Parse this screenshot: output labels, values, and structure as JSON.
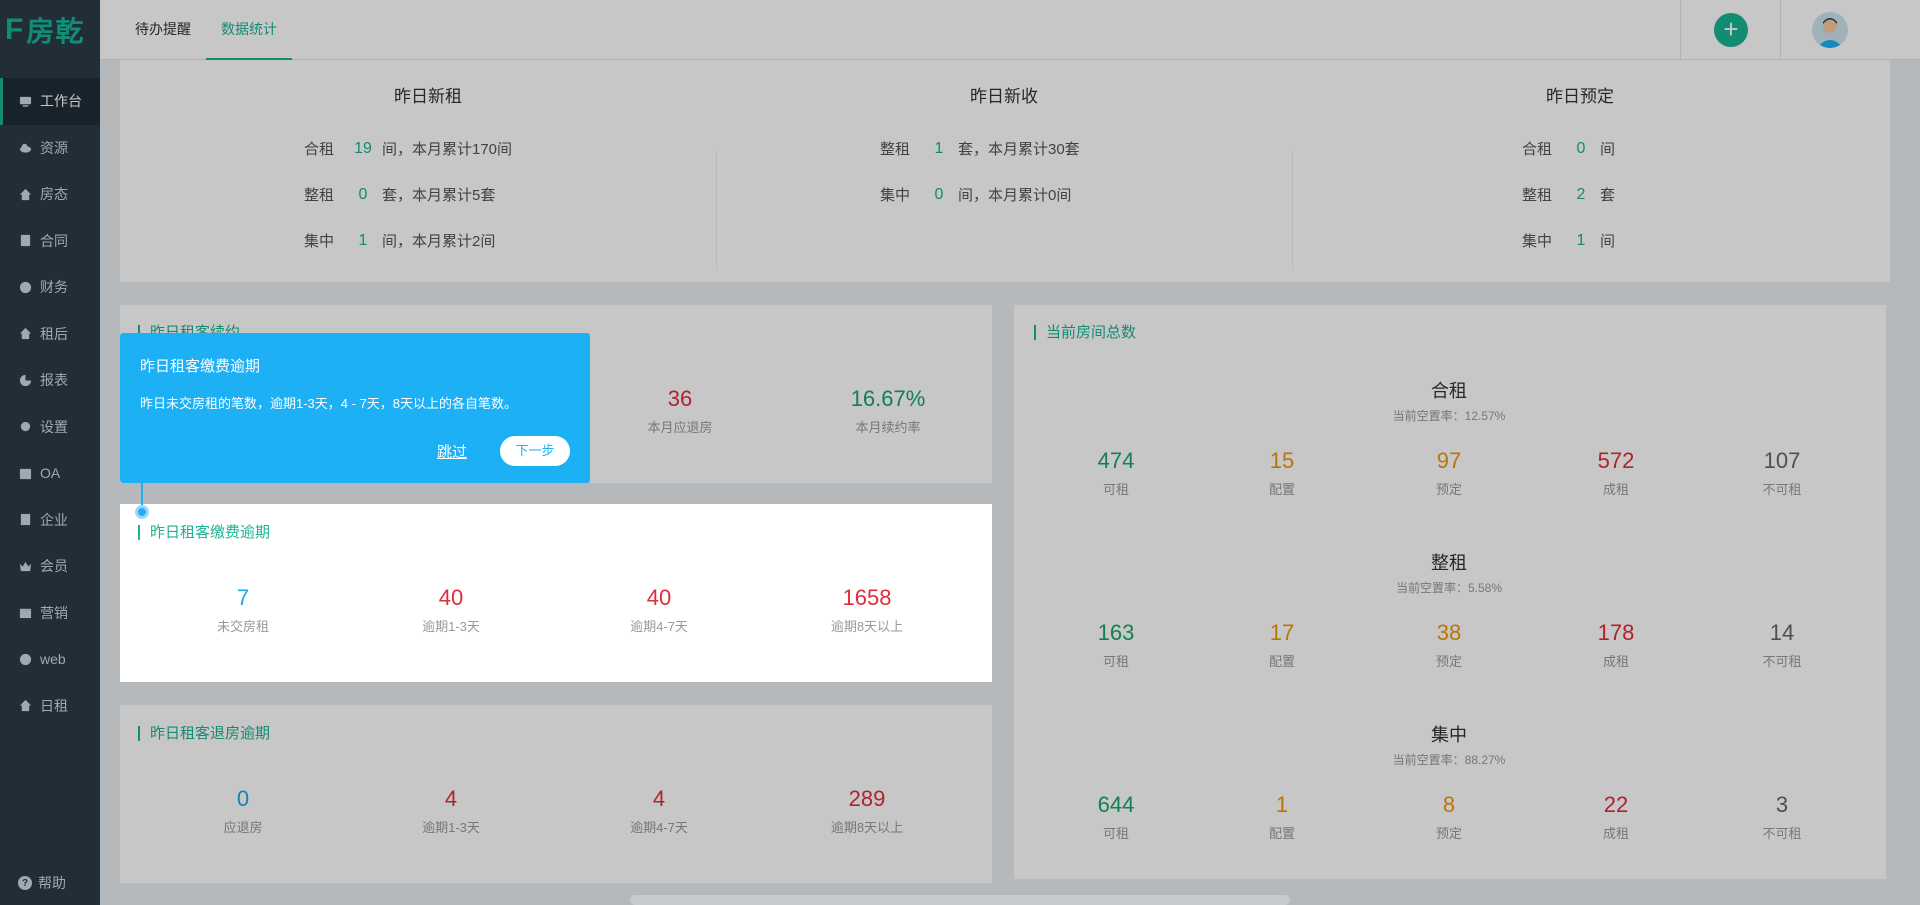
{
  "logo": {
    "text": "房乾",
    "mark": "F"
  },
  "sidebar": {
    "items": [
      {
        "label": "工作台",
        "icon": "monitor-icon"
      },
      {
        "label": "资源",
        "icon": "cloud-icon"
      },
      {
        "label": "房态",
        "icon": "home-icon"
      },
      {
        "label": "合同",
        "icon": "document-icon"
      },
      {
        "label": "财务",
        "icon": "yen-icon"
      },
      {
        "label": "租后",
        "icon": "home-icon"
      },
      {
        "label": "报表",
        "icon": "pie-chart-icon"
      },
      {
        "label": "设置",
        "icon": "gear-icon"
      },
      {
        "label": "OA",
        "icon": "checkbox-icon"
      },
      {
        "label": "企业",
        "icon": "building-icon"
      },
      {
        "label": "会员",
        "icon": "crown-icon"
      },
      {
        "label": "营销",
        "icon": "gift-icon"
      },
      {
        "label": "web",
        "icon": "ie-icon"
      },
      {
        "label": "日租",
        "icon": "home-icon"
      }
    ],
    "help": "帮助"
  },
  "header": {
    "tabs": [
      {
        "label": "待办提醒"
      },
      {
        "label": "数据统计"
      }
    ],
    "add": "+"
  },
  "summary": {
    "cols": [
      {
        "title": "昨日新租",
        "rows": [
          {
            "label": "合租",
            "num": "19",
            "suffix": "间，本月累计170间"
          },
          {
            "label": "整租",
            "num": "0",
            "suffix": "套，本月累计5套"
          },
          {
            "label": "集中",
            "num": "1",
            "suffix": "间，本月累计2间"
          }
        ]
      },
      {
        "title": "昨日新收",
        "rows": [
          {
            "label": "整租",
            "num": "1",
            "suffix": "套，本月累计30套"
          },
          {
            "label": "集中",
            "num": "0",
            "suffix": "间，本月累计0间"
          }
        ]
      },
      {
        "title": "昨日预定",
        "rows": [
          {
            "label": "合租",
            "num": "0",
            "suffix": "间"
          },
          {
            "label": "整租",
            "num": "2",
            "suffix": "套"
          },
          {
            "label": "集中",
            "num": "1",
            "suffix": "间"
          }
        ]
      }
    ]
  },
  "renewal": {
    "title": "昨日租客续约",
    "stats": [
      {
        "value": "36",
        "label": "本月应退房"
      },
      {
        "value": "16.67%",
        "label": "本月续约率"
      }
    ]
  },
  "overdue": {
    "title": "昨日租客缴费逾期",
    "stats": [
      {
        "value": "7",
        "label": "未交房租"
      },
      {
        "value": "40",
        "label": "逾期1-3天"
      },
      {
        "value": "40",
        "label": "逾期4-7天"
      },
      {
        "value": "1658",
        "label": "逾期8天以上"
      }
    ]
  },
  "checkout": {
    "title": "昨日租客退房逾期",
    "stats": [
      {
        "value": "0",
        "label": "应退房"
      },
      {
        "value": "4",
        "label": "逾期1-3天"
      },
      {
        "value": "4",
        "label": "逾期4-7天"
      },
      {
        "value": "289",
        "label": "逾期8天以上"
      }
    ]
  },
  "rooms": {
    "title": "当前房间总数",
    "groups": [
      {
        "name": "合租",
        "rate": "当前空置率：12.57%",
        "stats": [
          {
            "value": "474",
            "label": "可租"
          },
          {
            "value": "15",
            "label": "配置"
          },
          {
            "value": "97",
            "label": "预定"
          },
          {
            "value": "572",
            "label": "成租"
          },
          {
            "value": "107",
            "label": "不可租"
          }
        ]
      },
      {
        "name": "整租",
        "rate": "当前空置率：5.58%",
        "stats": [
          {
            "value": "163",
            "label": "可租"
          },
          {
            "value": "17",
            "label": "配置"
          },
          {
            "value": "38",
            "label": "预定"
          },
          {
            "value": "178",
            "label": "成租"
          },
          {
            "value": "14",
            "label": "不可租"
          }
        ]
      },
      {
        "name": "集中",
        "rate": "当前空置率：88.27%",
        "stats": [
          {
            "value": "644",
            "label": "可租"
          },
          {
            "value": "1",
            "label": "配置"
          },
          {
            "value": "8",
            "label": "预定"
          },
          {
            "value": "22",
            "label": "成租"
          },
          {
            "value": "3",
            "label": "不可租"
          }
        ]
      }
    ]
  },
  "tour": {
    "title": "昨日租客缴费逾期",
    "desc": "昨日未交房租的笔数，逾期1-3天，4 - 7天，8天以上的各自笔数。",
    "skip": "跳过",
    "next": "下一步"
  },
  "colors": {
    "accent": "#1ab394",
    "sidebar": "#2b3b48",
    "tip": "#1eb0f5",
    "red": "#e02c3c",
    "orange": "#f0960a",
    "green": "#1aa36b"
  }
}
